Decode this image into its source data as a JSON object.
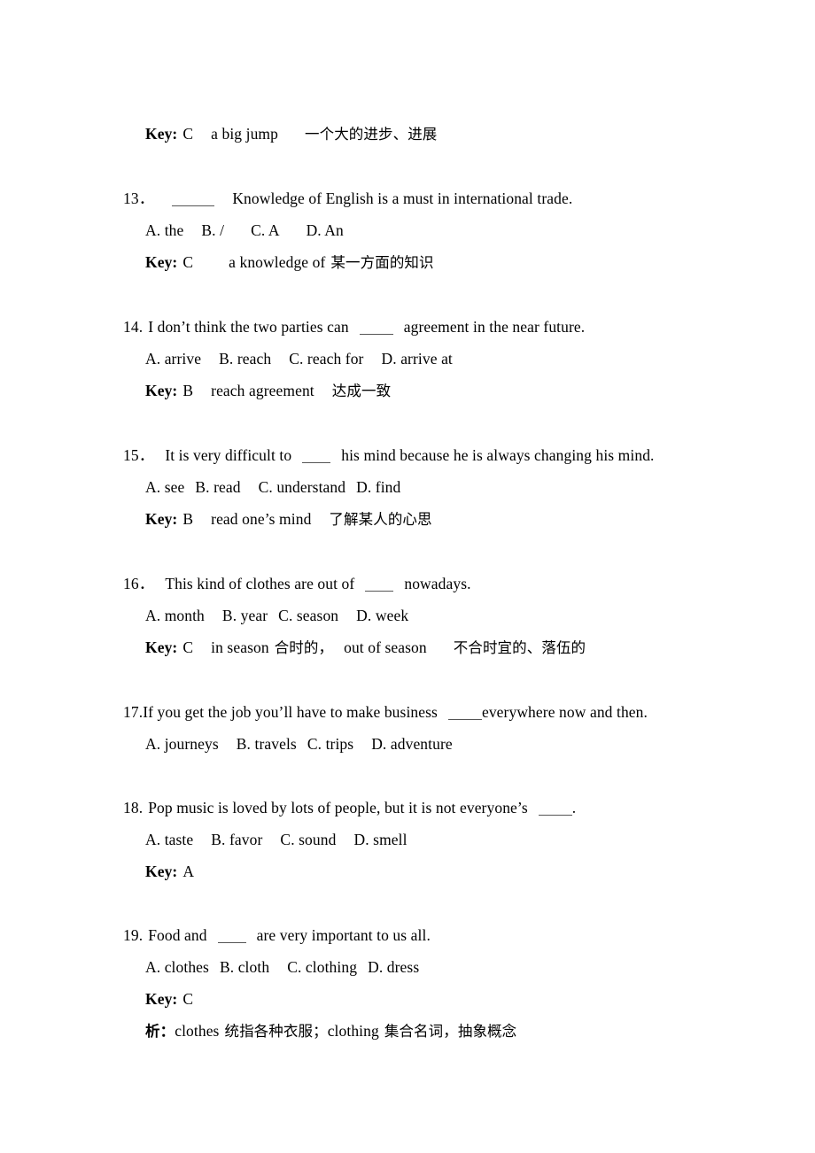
{
  "document": {
    "type": "exam-answer-key",
    "language": "English with Chinese annotations",
    "page_background": "#ffffff",
    "text_color": "#000000",
    "blank_rule_color": "#555555"
  },
  "labels": {
    "key_prefix": "Key:",
    "analysis_prefix": "析："
  },
  "leading_answer": {
    "key_letter": "C",
    "english_note": "a big jump",
    "chinese_note": "一个大的进步、进展"
  },
  "questions": [
    {
      "number": "13．",
      "stem_before": "",
      "stem_after": "Knowledge of English is a must in international trade.",
      "blank_size": "w-lg",
      "options": [
        "A. the",
        "B. /",
        "C. A",
        "D. An"
      ],
      "key_letter": "C",
      "english_note": "a knowledge of",
      "chinese_note": "某一方面的知识",
      "analysis": ""
    },
    {
      "number": "14.",
      "stem_before": "I don’t think the two parties can",
      "stem_after": "agreement in the near future.",
      "blank_size": "w-md",
      "options": [
        "A. arrive",
        "B. reach",
        "C. reach for",
        "D. arrive at"
      ],
      "key_letter": "B",
      "english_note": "reach agreement",
      "chinese_note": "达成一致",
      "analysis": ""
    },
    {
      "number": "15．",
      "stem_before": "It is very difficult to",
      "stem_after": "his mind because he is always changing his mind.",
      "blank_size": "w-sm",
      "options": [
        "A. see",
        "B. read",
        "C. understand",
        "D. find"
      ],
      "key_letter": "B",
      "english_note": "read one’s mind",
      "chinese_note": "了解某人的心思",
      "analysis": ""
    },
    {
      "number": "16．",
      "stem_before": "This kind of clothes are out of",
      "stem_after": "nowadays.",
      "blank_size": "w-sm",
      "options": [
        "A. month",
        "B. year",
        "C. season",
        "D. week"
      ],
      "key_letter": "C",
      "english_note": "in season",
      "chinese_note": "合时的，",
      "english_note_2": "out of season",
      "chinese_note_2": "不合时宜的、落伍的",
      "analysis": ""
    },
    {
      "number": "17.",
      "stem_before": "If you get the job you’ll have to make business",
      "stem_after": "everywhere now and then.",
      "blank_size": "w-md",
      "options": [
        "A. journeys",
        "B. travels",
        "C. trips",
        "D. adventure"
      ],
      "key_letter": "",
      "english_note": "",
      "chinese_note": "",
      "analysis": ""
    },
    {
      "number": "18.",
      "stem_before": "Pop music is loved by lots of people, but it is not everyone’s",
      "stem_after": ".",
      "blank_size": "w-md",
      "options": [
        "A. taste",
        "B. favor",
        "C. sound",
        "D. smell"
      ],
      "key_letter": "A",
      "english_note": "",
      "chinese_note": "",
      "analysis": ""
    },
    {
      "number": "19.",
      "stem_before": "Food and",
      "stem_after": "are very important to us all.",
      "blank_size": "w-sm",
      "options": [
        "A. clothes",
        "B. cloth",
        "C. clothing",
        "D. dress"
      ],
      "key_letter": "C",
      "english_note": "",
      "chinese_note": "",
      "analysis_en_1": "clothes",
      "analysis_cn_1": "统指各种衣服；",
      "analysis_en_2": "clothing",
      "analysis_cn_2": "集合名词，抽象概念"
    }
  ]
}
